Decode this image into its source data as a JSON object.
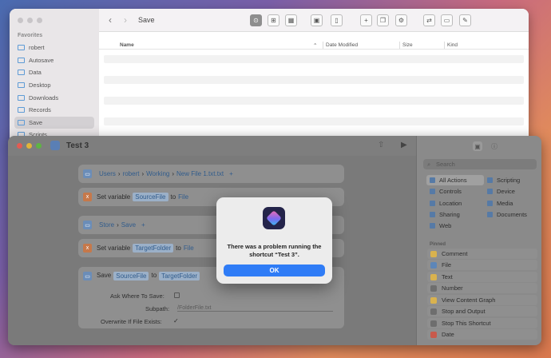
{
  "finder": {
    "title": "Save",
    "favorites_label": "Favorites",
    "sidebar": [
      "robert",
      "Autosave",
      "Data",
      "Desktop",
      "Downloads",
      "Records",
      "Save",
      "Scripts"
    ],
    "columns": {
      "name": "Name",
      "date": "Date Modified",
      "size": "Size",
      "kind": "Kind"
    },
    "nav": {
      "back": "‹",
      "forward": "›"
    }
  },
  "shortcuts": {
    "title": "Test 3",
    "actions": {
      "path1": {
        "seg1": "Users",
        "seg2": "robert",
        "seg3": "Working",
        "seg4": "New File 1.txt.txt"
      },
      "setvar1": {
        "label": "Set variable",
        "var": "SourceFile",
        "to": "to",
        "val": "File"
      },
      "path2": {
        "seg1": "Store",
        "seg2": "Save"
      },
      "setvar2": {
        "label": "Set variable",
        "var": "TargetFolder",
        "to": "to",
        "val": "File"
      },
      "save": {
        "label": "Save",
        "src": "SourceFile",
        "to": "to",
        "dest": "TargetFolder",
        "ask_label": "Ask Where To Save:",
        "subpath_label": "Subpath:",
        "subpath_placeholder": "/FolderFile.txt",
        "overwrite_label": "Overwrite If File Exists:",
        "overwrite_check": "✓"
      }
    },
    "panel": {
      "search_placeholder": "Search",
      "categories": {
        "all": "All Actions",
        "scripting": "Scripting",
        "controls": "Controls",
        "device": "Device",
        "location": "Location",
        "media": "Media",
        "sharing": "Sharing",
        "documents": "Documents",
        "web": "Web"
      },
      "pinned_label": "Pinned",
      "pinned": [
        "Comment",
        "File",
        "Text",
        "Number",
        "View Content Graph",
        "Stop and Output",
        "Stop This Shortcut",
        "Date"
      ]
    }
  },
  "dialog": {
    "message": "There was a problem running the shortcut “Test 3”.",
    "ok": "OK"
  },
  "colors": {
    "accent": "#2f7cf6",
    "variable": "#c6784a",
    "folder": "#6b8db8"
  }
}
